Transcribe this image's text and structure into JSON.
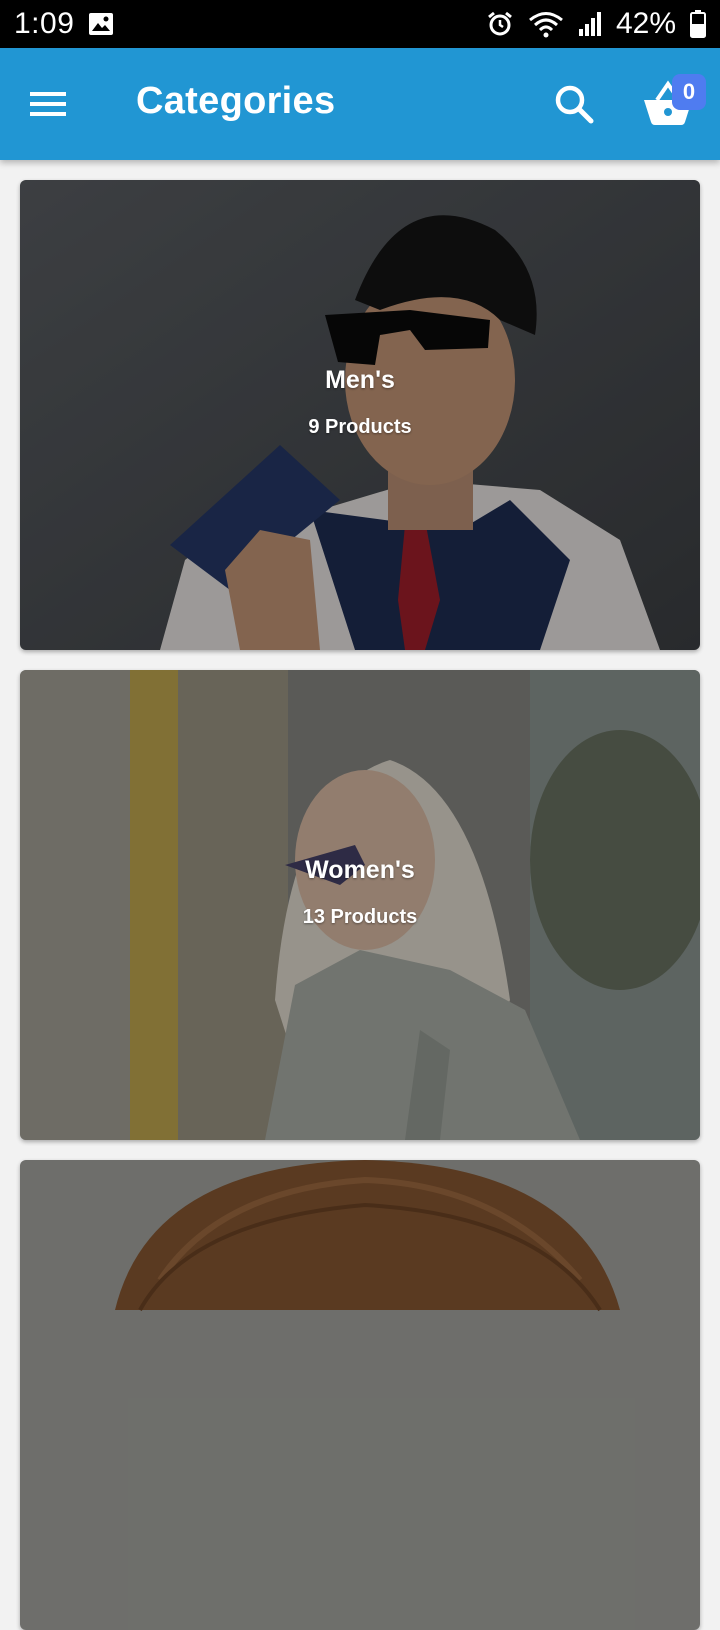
{
  "status_bar": {
    "time": "1:09",
    "battery_percent": "42%",
    "icons": [
      "image-icon",
      "alarm-icon",
      "wifi-icon",
      "signal-icon",
      "battery-icon"
    ]
  },
  "app_bar": {
    "title": "Categories",
    "cart_count": "0",
    "background_color": "#2196d3",
    "badge_color": "#4f7cf0"
  },
  "categories": [
    {
      "name": "Men's",
      "count_label": "9 Products"
    },
    {
      "name": "Women's",
      "count_label": "13 Products"
    },
    {
      "name": "",
      "count_label": ""
    }
  ]
}
